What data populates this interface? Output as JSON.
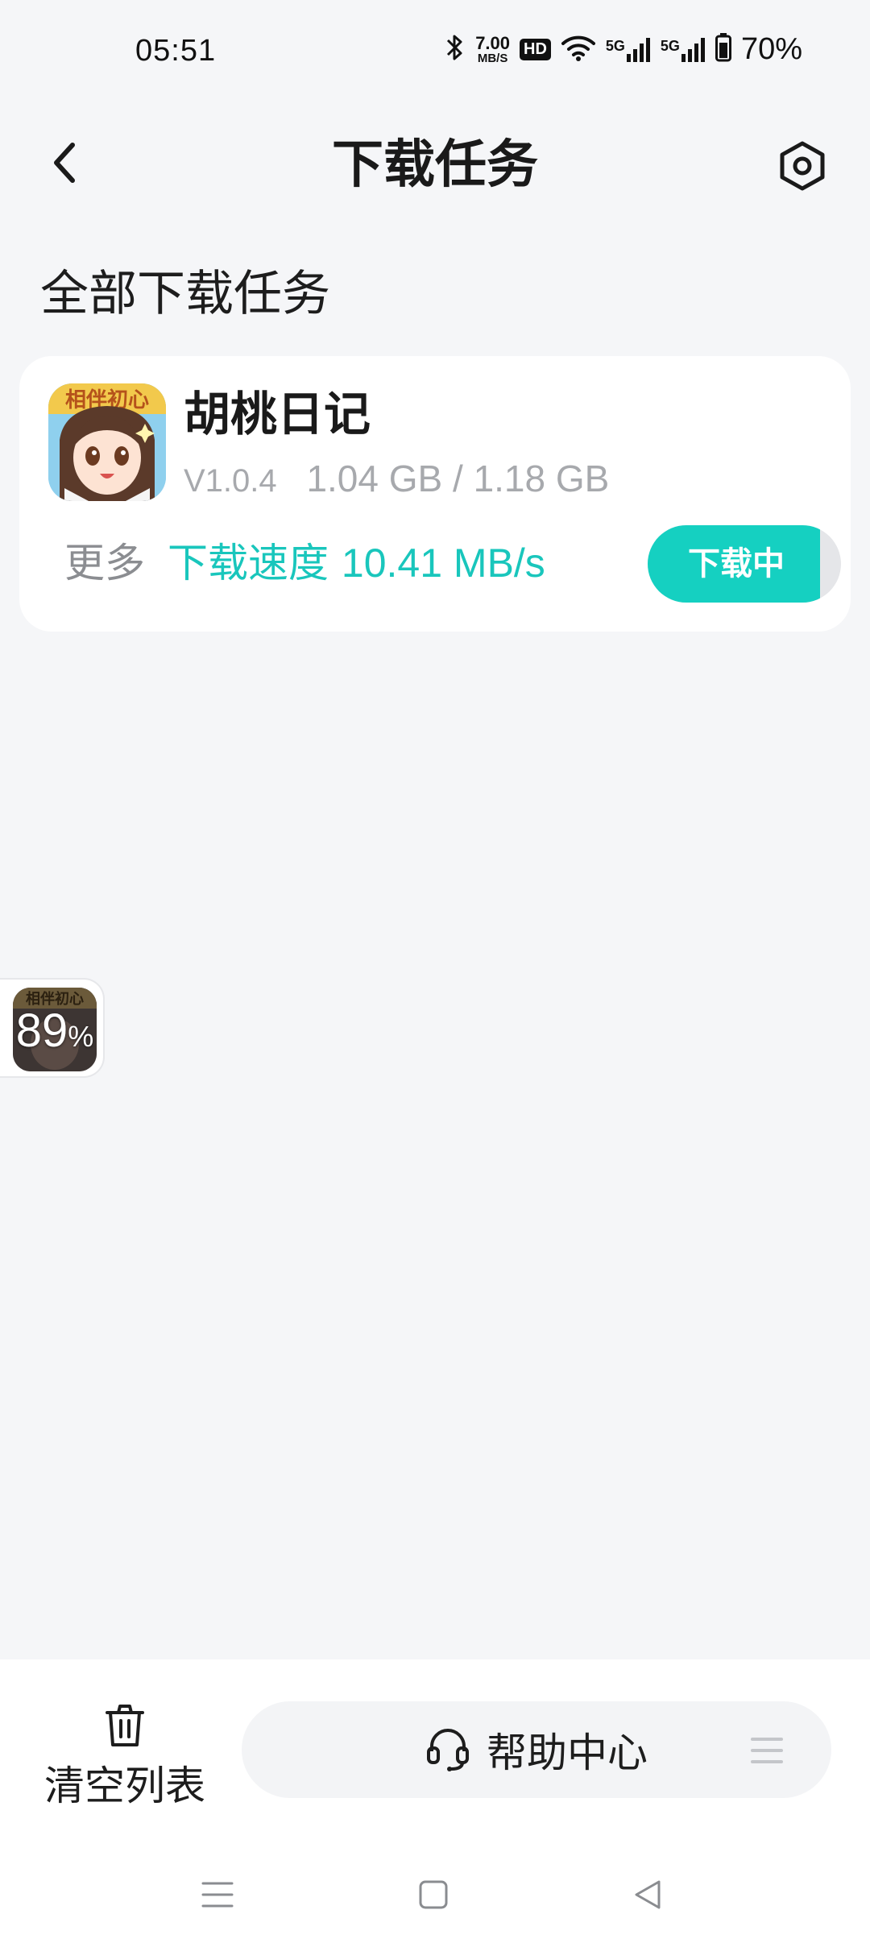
{
  "status_bar": {
    "time": "05:51",
    "net_speed_value": "7.00",
    "net_speed_unit": "MB/S",
    "hd_badge": "HD",
    "signal1": "5G",
    "signal2": "5G",
    "battery": "70%",
    "icons": [
      "bluetooth-icon",
      "hd-icon",
      "wifi-icon",
      "signal-5g-icon",
      "signal-5g-icon",
      "battery-icon"
    ]
  },
  "header": {
    "title": "下载任务",
    "back_icon": "chevron-left-icon",
    "settings_icon": "hexagon-settings-icon"
  },
  "section": {
    "title": "全部下载任务"
  },
  "task": {
    "name": "胡桃日记",
    "version": "V1.0.4",
    "downloaded": "1.04 GB",
    "separator": "/",
    "total": "1.18 GB",
    "more_label": "更多",
    "speed_label": "下载速度",
    "speed_value": "10.41 MB/s",
    "status_label": "下载中",
    "progress": 0.89,
    "icon_caption": "相伴初心"
  },
  "floating": {
    "percent": "89",
    "percent_sign": "%",
    "icon_caption": "相伴初心"
  },
  "bottom": {
    "clear_label": "清空列表",
    "clear_icon": "trash-icon",
    "help_label": "帮助中心",
    "help_icon": "headset-icon",
    "menu_icon": "menu-lines-icon"
  },
  "colors": {
    "accent": "#15d0c1",
    "speed_text": "#19c6bc",
    "background": "#f5f6f8"
  }
}
